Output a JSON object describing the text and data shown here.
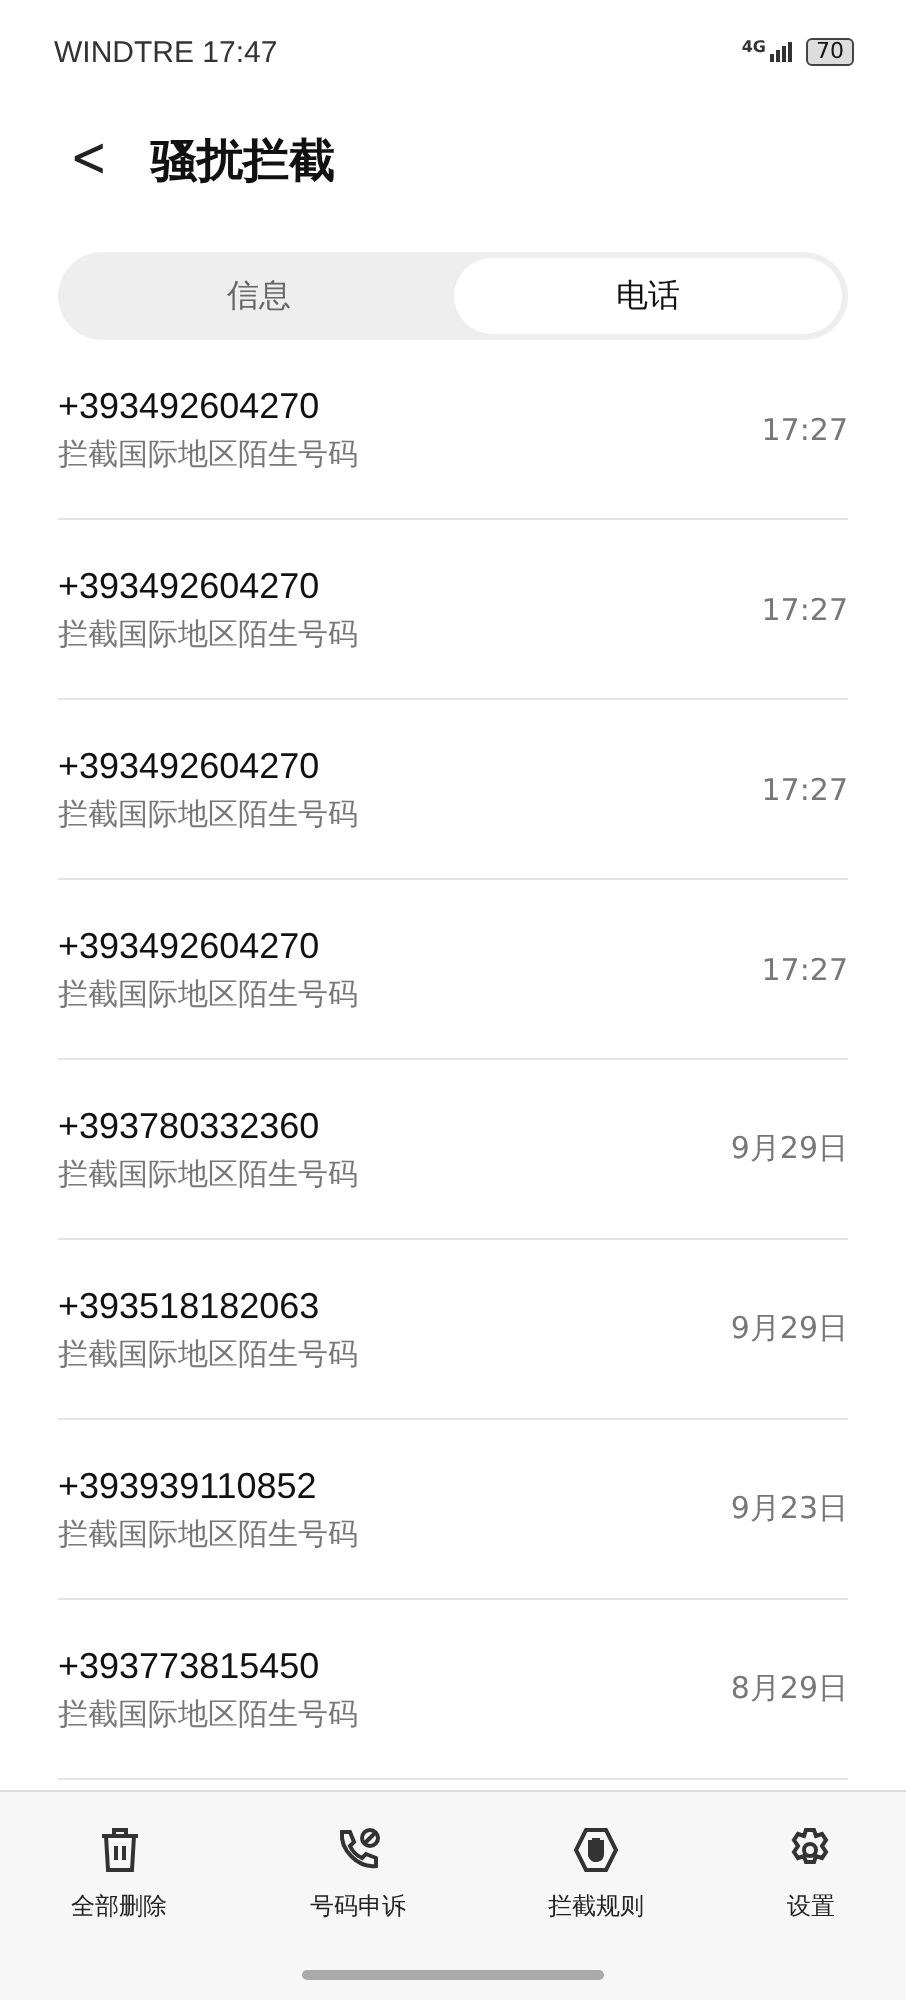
{
  "status_bar": {
    "carrier": "WINDTRE",
    "time": "17:47",
    "network": "4G",
    "battery": "70"
  },
  "header": {
    "back": "<",
    "title": "骚扰拦截"
  },
  "tabs": [
    {
      "label": "信息",
      "selected": false
    },
    {
      "label": "电话",
      "selected": true
    }
  ],
  "calls": [
    {
      "number": "+393492604270",
      "reason": "拦截国际地区陌生号码",
      "time": "17:27"
    },
    {
      "number": "+393492604270",
      "reason": "拦截国际地区陌生号码",
      "time": "17:27"
    },
    {
      "number": "+393492604270",
      "reason": "拦截国际地区陌生号码",
      "time": "17:27"
    },
    {
      "number": "+393492604270",
      "reason": "拦截国际地区陌生号码",
      "time": "17:27"
    },
    {
      "number": "+393780332360",
      "reason": "拦截国际地区陌生号码",
      "time": "9月29日"
    },
    {
      "number": "+393518182063",
      "reason": "拦截国际地区陌生号码",
      "time": "9月29日"
    },
    {
      "number": "+393939110852",
      "reason": "拦截国际地区陌生号码",
      "time": "9月23日"
    },
    {
      "number": "+393773815450",
      "reason": "拦截国际地区陌生号码",
      "time": "8月29日"
    }
  ],
  "toolbar": [
    {
      "kind": "trash",
      "label": "全部删除"
    },
    {
      "kind": "phone",
      "label": "号码申诉"
    },
    {
      "kind": "hand",
      "label": "拦截规则"
    },
    {
      "kind": "gear",
      "label": "设置"
    }
  ]
}
